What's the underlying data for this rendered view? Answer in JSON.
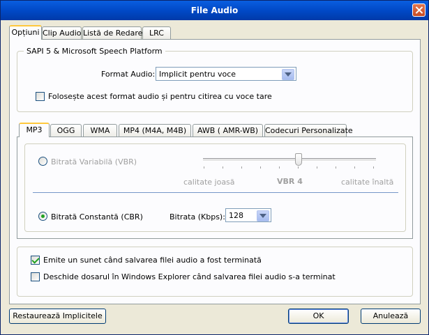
{
  "window": {
    "title": "File Audio"
  },
  "tabs": [
    "Opțiuni",
    "Clip Audio",
    "Listă de Redare",
    "LRC"
  ],
  "sapi": {
    "group_label": "SAPI 5 & Microsoft Speech Platform",
    "format_label": "Format Audio:",
    "format_value": "Implicit pentru voce",
    "use_format_label": "Folosește acest format audio și pentru citirea cu voce tare"
  },
  "format_tabs": [
    "MP3",
    "OGG",
    "WMA",
    "MP4 (M4A, M4B)",
    "AWB ( AMR-WB)",
    "Codecuri Personalizate"
  ],
  "mp3": {
    "vbr_label": "Bitrată Variabilă (VBR)",
    "low_quality": "calitate joasă",
    "vbr_value": "VBR 4",
    "high_quality": "calitate înaltă",
    "cbr_label": "Bitrată Constantă (CBR)",
    "bitrate_label": "Bitrata (Kbps):",
    "bitrate_value": "128",
    "vbr_selected": false,
    "cbr_selected": true
  },
  "options": {
    "sound_label": "Emite un sunet când salvarea filei audio a fost terminată",
    "sound_checked": true,
    "explorer_label": "Deschide dosarul în Windows Explorer când salvarea filei audio s-a terminat",
    "explorer_checked": false
  },
  "buttons": {
    "restore": "Restaurează Implicitele",
    "ok": "OK",
    "cancel": "Anulează"
  },
  "colors": {
    "titlebar": "#0054e3",
    "tab_highlight": "#ffc83c",
    "check": "#21a121"
  }
}
